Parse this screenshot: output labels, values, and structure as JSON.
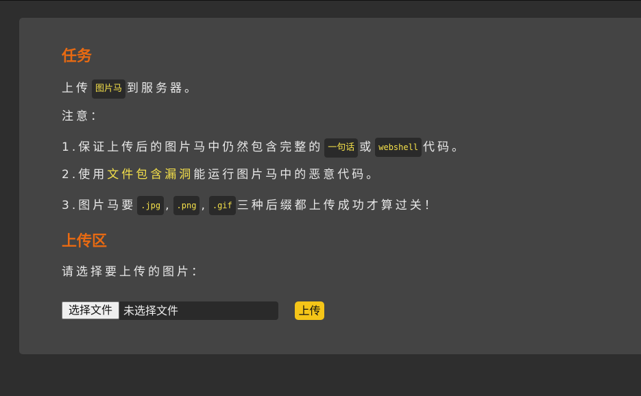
{
  "task": {
    "heading": "任务",
    "intro_pre": "上传",
    "intro_code": "图片马",
    "intro_post": "到服务器。",
    "note_label": "注意：",
    "item1_pre": "1.保证上传后的图片马中仍然包含完整的",
    "item1_code1": "一句话",
    "item1_mid": "或",
    "item1_code2": "webshell",
    "item1_post": "代码。",
    "item2_pre": "2.使用",
    "item2_highlight": "文件包含漏洞",
    "item2_post": "能运行图片马中的恶意代码。",
    "item3_pre": "3.图片马要",
    "item3_ext1": ".jpg",
    "item3_sep1": ",",
    "item3_ext2": ".png",
    "item3_sep2": ",",
    "item3_ext3": ".gif",
    "item3_post": "三种后缀都上传成功才算过关！"
  },
  "upload": {
    "heading": "上传区",
    "prompt": "请选择要上传的图片：",
    "choose_file_label": "选择文件",
    "no_file_text": "未选择文件",
    "submit_label": "上传"
  },
  "colors": {
    "heading": "#e86a12",
    "highlight": "#f4e04a",
    "panel": "#444444",
    "background": "#2e2e2e",
    "upload_button": "#f5c518"
  }
}
